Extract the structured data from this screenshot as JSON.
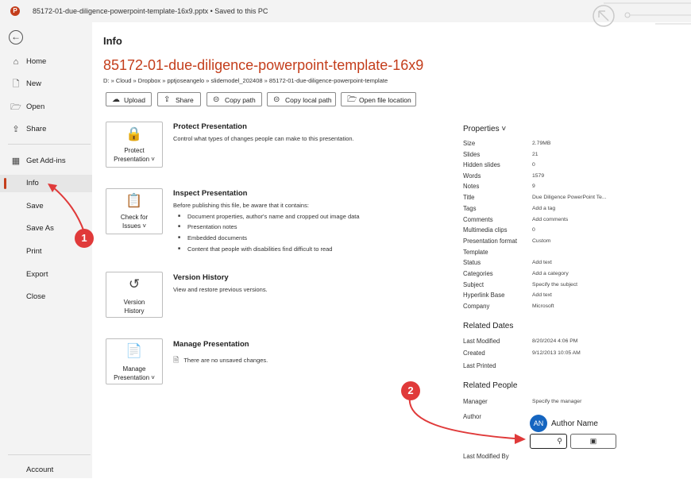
{
  "window": {
    "title": "85172-01-due-diligence-powerpoint-template-16x9.pptx • Saved to this PC",
    "app_letter": "P"
  },
  "sidebar": {
    "back_glyph": "←",
    "items": [
      {
        "label": "Home",
        "icon": "home-icon",
        "glyph": "⌂"
      },
      {
        "label": "New",
        "icon": "new-document-icon",
        "glyph": "🗋"
      },
      {
        "label": "Open",
        "icon": "folder-open-icon",
        "glyph": "🗁"
      },
      {
        "label": "Share",
        "icon": "share-icon",
        "glyph": "⇪"
      },
      {
        "label": "Get Add-ins",
        "icon": "add-ins-icon",
        "glyph": "▦"
      },
      {
        "label": "Info",
        "active": true
      },
      {
        "label": "Save"
      },
      {
        "label": "Save As"
      },
      {
        "label": "Print"
      },
      {
        "label": "Export"
      },
      {
        "label": "Close"
      }
    ],
    "account_label": "Account"
  },
  "main": {
    "title": "Info",
    "file_name": "85172-01-due-diligence-powerpoint-template-16x9",
    "path": "D: » Cloud » Dropbox » pptjoseangelo » slidemodel_202408 » 85172-01-due-diligence-powerpoint-template",
    "actions": [
      {
        "label": "Upload",
        "icon": "upload-cloud-icon",
        "glyph": "☁"
      },
      {
        "label": "Share",
        "icon": "share-icon",
        "glyph": "⇪"
      },
      {
        "label": "Copy path",
        "icon": "link-icon",
        "glyph": "⊝"
      },
      {
        "label": "Copy local path",
        "icon": "link-icon",
        "glyph": "⊝"
      },
      {
        "label": "Open file location",
        "icon": "folder-icon",
        "glyph": "🗁"
      }
    ],
    "sections": {
      "protect": {
        "tile_line1": "Protect",
        "tile_line2": "Presentation ˅",
        "title": "Protect Presentation",
        "desc": "Control what types of changes people can make to this presentation.",
        "glyph": "🔒"
      },
      "inspect": {
        "tile_line1": "Check for",
        "tile_line2": "Issues ˅",
        "title": "Inspect Presentation",
        "desc": "Before publishing this file, be aware that it contains:",
        "glyph": "📋",
        "bullets": [
          "Document properties, author's name and cropped out image data",
          "Presentation notes",
          "Embedded documents",
          "Content that people with disabilities find difficult to read"
        ]
      },
      "version": {
        "tile_line1": "Version",
        "tile_line2": "History",
        "title": "Version History",
        "desc": "View and restore previous versions.",
        "glyph": "↺"
      },
      "manage": {
        "tile_line1": "Manage",
        "tile_line2": "Presentation ˅",
        "title": "Manage Presentation",
        "desc": "There are no unsaved changes.",
        "glyph": "📄"
      }
    }
  },
  "properties": {
    "header": "Properties ˅",
    "rows": [
      {
        "k": "Size",
        "v": "2.79MB"
      },
      {
        "k": "Slides",
        "v": "21"
      },
      {
        "k": "Hidden slides",
        "v": "0"
      },
      {
        "k": "Words",
        "v": "1579"
      },
      {
        "k": "Notes",
        "v": "9"
      },
      {
        "k": "Title",
        "v": "Due Diligence PowerPoint Te..."
      },
      {
        "k": "Tags",
        "v": "Add a tag"
      },
      {
        "k": "Comments",
        "v": "Add comments"
      },
      {
        "k": "Multimedia clips",
        "v": "0"
      },
      {
        "k": "Presentation format",
        "v": "Custom"
      },
      {
        "k": "Template",
        "v": ""
      },
      {
        "k": "Status",
        "v": "Add text"
      },
      {
        "k": "Categories",
        "v": "Add a category"
      },
      {
        "k": "Subject",
        "v": "Specify the subject"
      },
      {
        "k": "Hyperlink Base",
        "v": "Add text"
      },
      {
        "k": "Company",
        "v": "Microsoft"
      }
    ],
    "dates_header": "Related Dates",
    "dates": [
      {
        "k": "Last Modified",
        "v": "8/20/2024 4:06 PM"
      },
      {
        "k": "Created",
        "v": "9/12/2013 10:05 AM"
      },
      {
        "k": "Last Printed",
        "v": ""
      }
    ],
    "people_header": "Related People",
    "manager_label": "Manager",
    "manager_value": "Specify the manager",
    "author_label": "Author",
    "author_initials": "AN",
    "author_name": "Author Name",
    "add_author_glyph": "⚲",
    "browse_glyph": "▣",
    "last_modified_by_label": "Last Modified By"
  },
  "annotations": {
    "badge1": "1",
    "badge2": "2",
    "color": "#e03a3a"
  }
}
